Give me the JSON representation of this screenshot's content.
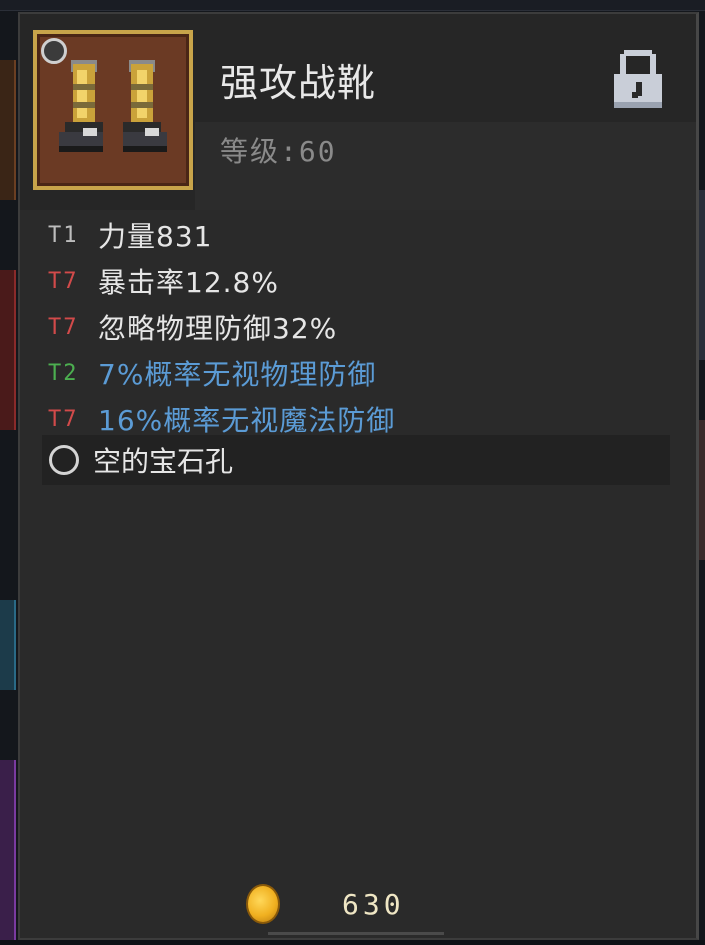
{
  "item": {
    "name": "强攻战靴",
    "level_text": "等级:60",
    "icon": "golden-boots-icon",
    "frame_color": "#c8a44a",
    "locked": true,
    "lock_icon": "padlock-icon"
  },
  "stats": [
    {
      "tier": "T1",
      "tier_color": "#bdbdbd",
      "text": "力量831",
      "text_color": "#e6e6e6"
    },
    {
      "tier": "T7",
      "tier_color": "#d24a4a",
      "text": "暴击率12.8%",
      "text_color": "#e6e6e6"
    },
    {
      "tier": "T7",
      "tier_color": "#d24a4a",
      "text": "忽略物理防御32%",
      "text_color": "#e6e6e6"
    },
    {
      "tier": "T2",
      "tier_color": "#4caf50",
      "text": "7%概率无视物理防御",
      "text_color": "#5b9bd5"
    },
    {
      "tier": "T7",
      "tier_color": "#d24a4a",
      "text": "16%概率无视魔法防御",
      "text_color": "#5b9bd5"
    }
  ],
  "gem_slot": {
    "label": "空的宝石孔",
    "icon": "empty-socket-icon"
  },
  "price": {
    "value": "630",
    "icon": "gold-coin-icon"
  }
}
